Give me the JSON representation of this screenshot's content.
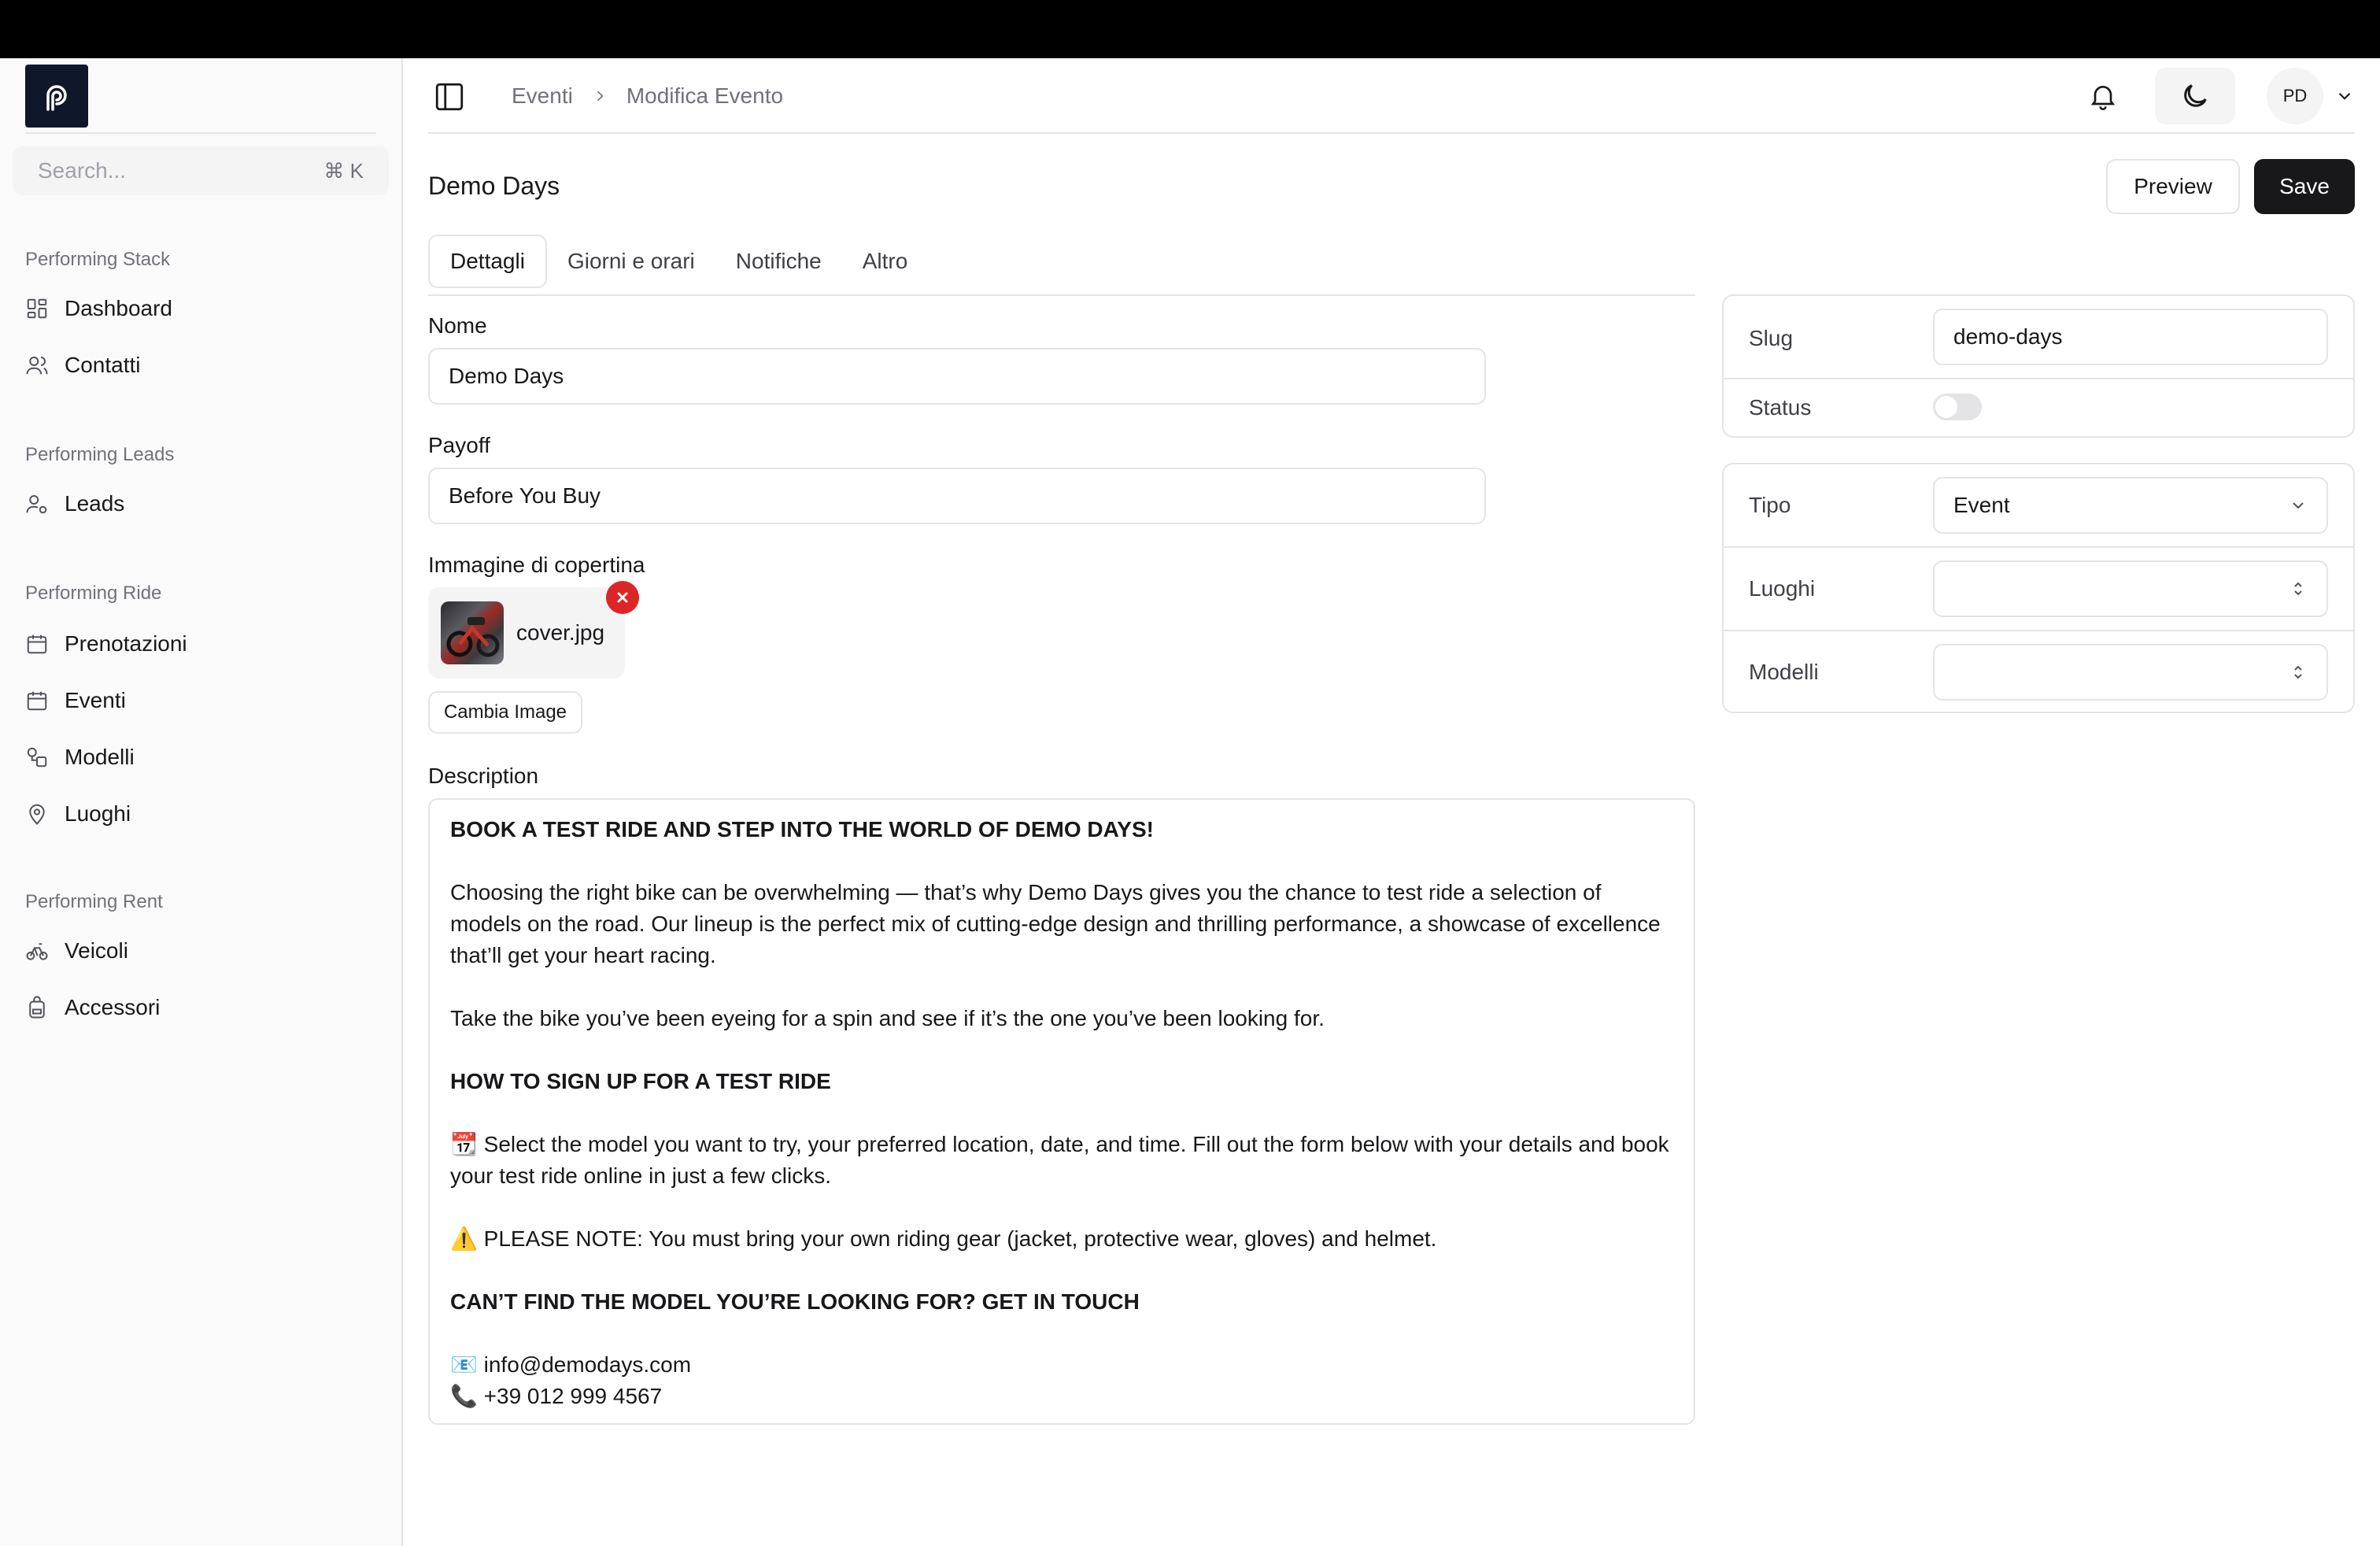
{
  "sidebar": {
    "search": {
      "placeholder": "Search...",
      "shortcut": "⌘ K"
    },
    "groups": [
      {
        "label": "Performing Stack",
        "items": [
          {
            "label": "Dashboard",
            "icon": "dashboard-icon"
          },
          {
            "label": "Contatti",
            "icon": "users-icon"
          }
        ]
      },
      {
        "label": "Performing Leads",
        "items": [
          {
            "label": "Leads",
            "icon": "user-key-icon"
          }
        ]
      },
      {
        "label": "Performing Ride",
        "items": [
          {
            "label": "Prenotazioni",
            "icon": "calendar-icon"
          },
          {
            "label": "Eventi",
            "icon": "calendar-icon"
          },
          {
            "label": "Modelli",
            "icon": "shapes-icon"
          },
          {
            "label": "Luoghi",
            "icon": "map-pin-icon"
          }
        ]
      },
      {
        "label": "Performing Rent",
        "items": [
          {
            "label": "Veicoli",
            "icon": "bike-icon"
          },
          {
            "label": "Accessori",
            "icon": "backpack-icon"
          }
        ]
      }
    ]
  },
  "header": {
    "breadcrumb": [
      "Eventi",
      "Modifica Evento"
    ],
    "user_initials": "PD"
  },
  "page": {
    "title": "Demo Days",
    "preview_label": "Preview",
    "save_label": "Save"
  },
  "tabs": [
    {
      "label": "Dettagli",
      "active": true
    },
    {
      "label": "Giorni e orari",
      "active": false
    },
    {
      "label": "Notifiche",
      "active": false
    },
    {
      "label": "Altro",
      "active": false
    }
  ],
  "form": {
    "nome": {
      "label": "Nome",
      "value": "Demo Days"
    },
    "payoff": {
      "label": "Payoff",
      "value": "Before You Buy"
    },
    "cover": {
      "label": "Immagine di copertina",
      "filename": "cover.jpg",
      "change_label": "Cambia Image"
    },
    "description": {
      "label": "Description",
      "heading1": "BOOK A TEST RIDE AND STEP INTO THE WORLD OF DEMO DAYS!",
      "para1": "Choosing the right bike can be overwhelming — that’s why Demo Days gives you the chance to test ride a selection of models on the road. Our lineup is the perfect mix of cutting-edge design and thrilling performance, a showcase of excellence that’ll get your heart racing.",
      "para2": "Take the bike you’ve been eyeing for a spin and see if it’s the one you’ve been looking for.",
      "heading2": "HOW TO SIGN UP FOR A TEST RIDE",
      "para3": "📆 Select the model you want to try, your preferred location, date, and time. Fill out the form below with your details and book your test ride online in just a few clicks.",
      "para4": "⚠️ PLEASE NOTE: You must bring your own riding gear (jacket, protective wear, gloves) and helmet.",
      "heading3": "CAN’T FIND THE MODEL YOU’RE LOOKING FOR? GET IN TOUCH",
      "email": "📧 info@demodays.com",
      "phone": "📞 +39 012 999 4567"
    }
  },
  "side": {
    "slug": {
      "label": "Slug",
      "value": "demo-days"
    },
    "status": {
      "label": "Status",
      "on": false
    },
    "tipo": {
      "label": "Tipo",
      "value": "Event"
    },
    "luoghi": {
      "label": "Luoghi",
      "value": ""
    },
    "modelli": {
      "label": "Modelli",
      "value": ""
    }
  }
}
